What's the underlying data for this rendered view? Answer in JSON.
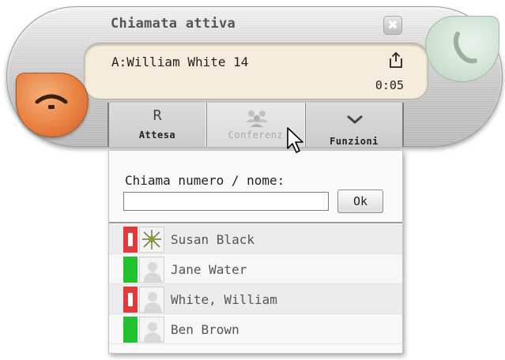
{
  "call_widget": {
    "title": "Chiamata attiva",
    "caller": "A:William White 14",
    "timer": "0:05",
    "icons": {
      "close": "close-icon",
      "share": "share-icon",
      "hangup": "hangup-phone-icon",
      "answer": "answer-phone-icon"
    },
    "colors": {
      "hangup": "#e8813f",
      "answer": "#cfe2d2",
      "info_bg": "#f5ecdc"
    }
  },
  "toolbar": {
    "hold": {
      "glyph": "R",
      "label": "Attesa"
    },
    "conference": {
      "label": "Conferenz",
      "icon": "conference-icon"
    },
    "functions": {
      "label": "Funzioni",
      "icon": "chevron-down-icon"
    }
  },
  "dial_panel": {
    "label": "Chiama numero / nome:",
    "input_value": "",
    "ok_label": "Ok"
  },
  "contacts": [
    {
      "name": "Susan Black",
      "status": "busy",
      "avatar": "spider-icon"
    },
    {
      "name": "Jane Water",
      "status": "free",
      "avatar": "user-placeholder-icon"
    },
    {
      "name": "White, William",
      "status": "busy",
      "avatar": "user-placeholder-icon"
    },
    {
      "name": "Ben Brown",
      "status": "free",
      "avatar": "user-placeholder-icon"
    }
  ],
  "status_colors": {
    "busy": "#e23a3a",
    "free": "#22c22e"
  }
}
